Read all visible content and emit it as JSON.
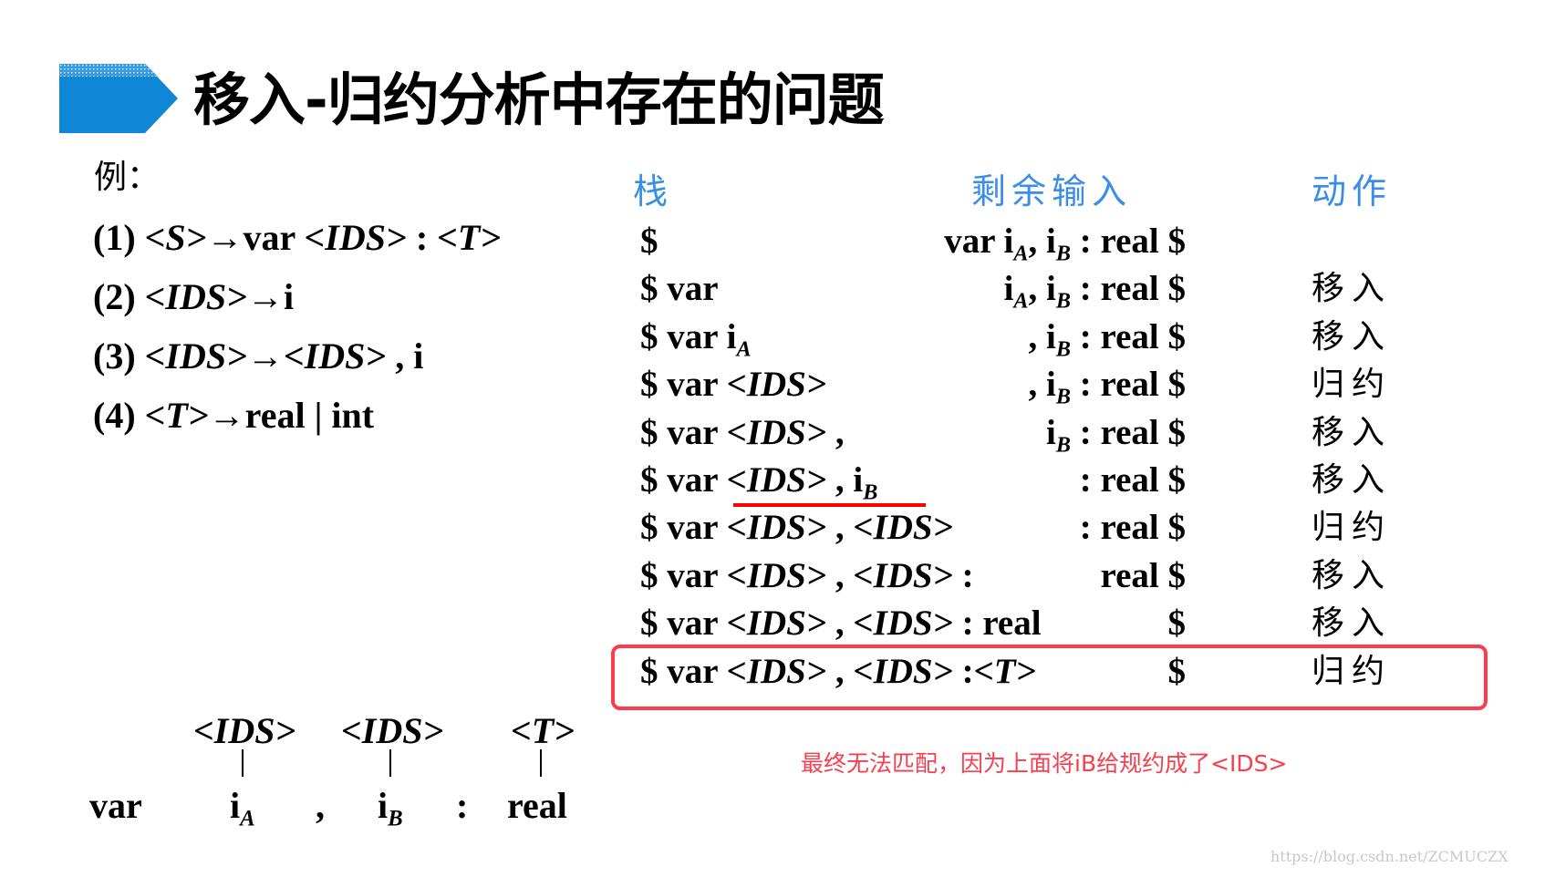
{
  "title": "移入-归约分析中存在的问题",
  "colors": {
    "accent": "#0f87d6",
    "header": "#3b8ee8",
    "highlight": "#fe3b4a",
    "underline": "#ff0000"
  },
  "example": {
    "label": "例：",
    "rules": [
      {
        "num": "(1)",
        "lhs": "<S>",
        "arrow": "→",
        "rhs": [
          [
            "t",
            "var "
          ],
          [
            "nt",
            "<IDS>"
          ],
          [
            "t",
            " : "
          ],
          [
            "nt",
            "<T>"
          ]
        ]
      },
      {
        "num": "(2)",
        "lhs": "<IDS>",
        "arrow": "→",
        "rhs": [
          [
            "t",
            "i"
          ]
        ]
      },
      {
        "num": "(3)",
        "lhs": "<IDS>",
        "arrow": "→",
        "rhs": [
          [
            "nt",
            "<IDS>"
          ],
          [
            "t",
            " , i"
          ]
        ]
      },
      {
        "num": "(4)",
        "lhs": "<T>",
        "arrow": "→",
        "rhs": [
          [
            "t",
            "real | int"
          ]
        ]
      }
    ]
  },
  "table": {
    "headers": {
      "stack": "栈",
      "input": "剩余输入",
      "action": "动作"
    },
    "rows": [
      {
        "stack": [
          [
            "t",
            "$"
          ]
        ],
        "input": [
          [
            "t",
            "var i"
          ],
          [
            "sub",
            "A"
          ],
          [
            "t",
            ", i"
          ],
          [
            "sub",
            "B"
          ],
          [
            "t",
            " : real $"
          ]
        ],
        "action": ""
      },
      {
        "stack": [
          [
            "t",
            "$ var"
          ]
        ],
        "input": [
          [
            "t",
            "i"
          ],
          [
            "sub",
            "A"
          ],
          [
            "t",
            ", i"
          ],
          [
            "sub",
            "B"
          ],
          [
            "t",
            " : real $"
          ]
        ],
        "action": "移入"
      },
      {
        "stack": [
          [
            "t",
            "$ var i"
          ],
          [
            "sub",
            "A"
          ]
        ],
        "input": [
          [
            "t",
            ", i"
          ],
          [
            "sub",
            "B"
          ],
          [
            "t",
            " : real $"
          ]
        ],
        "action": "移入"
      },
      {
        "stack": [
          [
            "t",
            "$ var "
          ],
          [
            "nt",
            "<IDS>"
          ]
        ],
        "input": [
          [
            "t",
            ", i"
          ],
          [
            "sub",
            "B"
          ],
          [
            "t",
            " : real $"
          ]
        ],
        "action": "归约"
      },
      {
        "stack": [
          [
            "t",
            "$ var "
          ],
          [
            "nt",
            "<IDS>"
          ],
          [
            "t",
            " ,"
          ]
        ],
        "input": [
          [
            "t",
            "i"
          ],
          [
            "sub",
            "B"
          ],
          [
            "t",
            " : real $"
          ]
        ],
        "action": "移入"
      },
      {
        "stack": [
          [
            "t",
            "$ var "
          ],
          [
            "nt",
            "<IDS>"
          ],
          [
            "t",
            " ,  i"
          ],
          [
            "sub",
            "B"
          ]
        ],
        "input": [
          [
            "t",
            ": real $"
          ]
        ],
        "action": "移入"
      },
      {
        "stack": [
          [
            "t",
            "$ var "
          ],
          [
            "nt",
            "<IDS>"
          ],
          [
            "t",
            " , "
          ],
          [
            "nt",
            "<IDS>"
          ]
        ],
        "input": [
          [
            "t",
            ": real $"
          ]
        ],
        "action": "归约"
      },
      {
        "stack": [
          [
            "t",
            "$ var "
          ],
          [
            "nt",
            "<IDS>"
          ],
          [
            "t",
            " , "
          ],
          [
            "nt",
            "<IDS>"
          ],
          [
            "t",
            " :"
          ]
        ],
        "input": [
          [
            "t",
            "real $"
          ]
        ],
        "action": "移入"
      },
      {
        "stack": [
          [
            "t",
            "$ var "
          ],
          [
            "nt",
            "<IDS>"
          ],
          [
            "t",
            " , "
          ],
          [
            "nt",
            "<IDS>"
          ],
          [
            "t",
            " : real"
          ]
        ],
        "input": [
          [
            "t",
            "$"
          ]
        ],
        "action": "移入"
      },
      {
        "stack": [
          [
            "t",
            "$ var "
          ],
          [
            "nt",
            "<IDS>"
          ],
          [
            "t",
            " , "
          ],
          [
            "nt",
            "<IDS>"
          ],
          [
            "t",
            " :"
          ],
          [
            "nt",
            "<T>"
          ]
        ],
        "input": [
          [
            "t",
            "$"
          ]
        ],
        "action": "归约"
      }
    ],
    "underlined_row": 5,
    "highlighted_row": 9
  },
  "note": "最终无法匹配，因为上面将iB给规约成了<IDS>",
  "parse_tree": {
    "nonterminals": [
      "<IDS>",
      "<IDS>",
      "<T>"
    ],
    "leaves": [
      [
        [
          "t",
          "var"
        ]
      ],
      [
        [
          "t",
          "i"
        ],
        [
          "sub",
          "A"
        ]
      ],
      [
        [
          "t",
          ","
        ]
      ],
      [
        [
          "t",
          "i"
        ],
        [
          "sub",
          "B"
        ]
      ],
      [
        [
          "t",
          ":"
        ]
      ],
      [
        [
          "t",
          "real"
        ]
      ]
    ]
  },
  "watermark": "https://blog.csdn.net/ZCMUCZX"
}
